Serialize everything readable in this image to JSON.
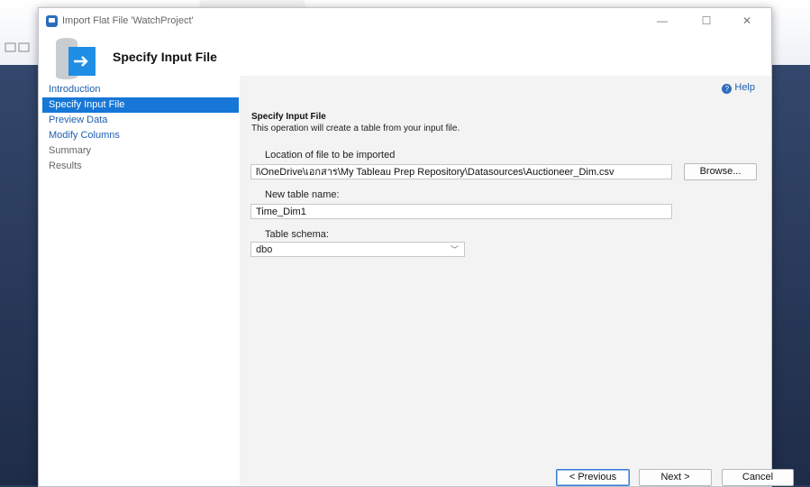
{
  "window": {
    "title": "Import Flat File 'WatchProject'",
    "minimize_glyph": "—",
    "maximize_glyph": "☐",
    "close_glyph": "✕"
  },
  "header": {
    "title": "Specify Input File",
    "icon": "database-import-icon"
  },
  "nav": {
    "items": [
      {
        "label": "Introduction",
        "state": "link"
      },
      {
        "label": "Specify Input File",
        "state": "active"
      },
      {
        "label": "Preview Data",
        "state": "link"
      },
      {
        "label": "Modify Columns",
        "state": "link"
      },
      {
        "label": "Summary",
        "state": "disabled"
      },
      {
        "label": "Results",
        "state": "disabled"
      }
    ]
  },
  "content": {
    "help_label": "Help",
    "help_icon": "?",
    "section_title": "Specify Input File",
    "section_desc": "This operation will create a table from your input file.",
    "location_label": "Location of file to be imported",
    "file_path": "l\\OneDrive\\เอกสาร\\My Tableau Prep Repository\\Datasources\\Auctioneer_Dim.csv",
    "browse_label": "Browse...",
    "table_name_label": "New table name:",
    "table_name_value": "Time_Dim1",
    "schema_label": "Table schema:",
    "schema_value": "dbo",
    "schema_chevron": "﹀"
  },
  "footer": {
    "previous_label": "< Previous",
    "next_label": "Next >",
    "cancel_label": "Cancel"
  },
  "colors": {
    "accent": "#1677d6",
    "link": "#1f5fb0",
    "content_bg": "#f3f3f3"
  }
}
